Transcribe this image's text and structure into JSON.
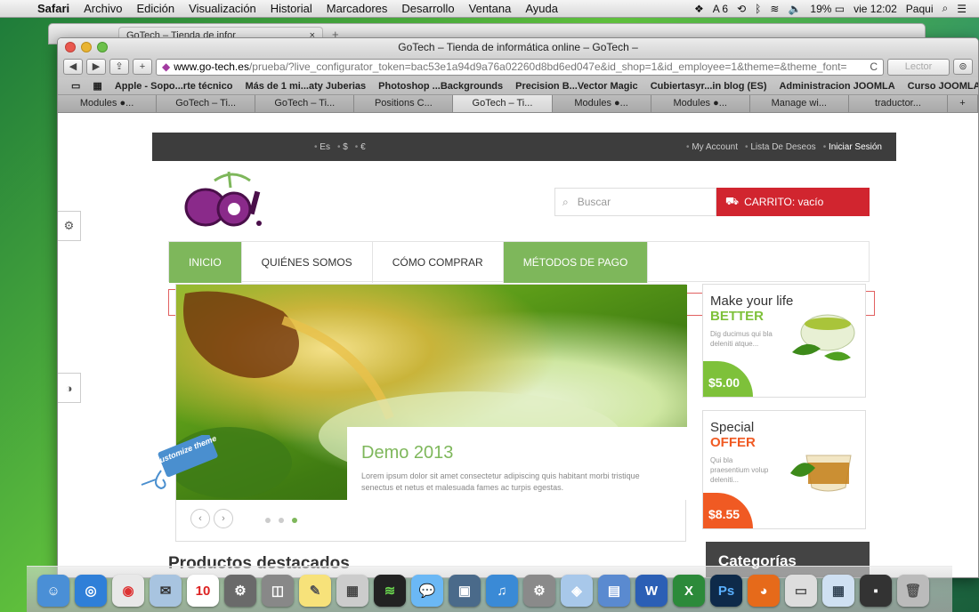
{
  "menubar": {
    "items": [
      "Safari",
      "Archivo",
      "Edición",
      "Visualización",
      "Historial",
      "Marcadores",
      "Desarrollo",
      "Ventana",
      "Ayuda"
    ],
    "status": {
      "adobe": "6",
      "battery": "19%",
      "clock": "vie 12:02",
      "user": "Paqui"
    }
  },
  "bg_window": {
    "tab_title": "GoTech – Tienda de infor",
    "tab_close": "×",
    "new_tab": "+"
  },
  "window": {
    "title": "GoTech – Tienda de informática online – GoTech –"
  },
  "toolbar": {
    "back": "◀",
    "forward": "▶",
    "share": "⇪",
    "add": "+",
    "url_domain": "www.go-tech.es",
    "url_path": "/prueba/?live_configurator_token=bac53e1a94d9a76a02260d8bd6ed047e&id_shop=1&id_employee=1&theme=&theme_font=",
    "reload": "C",
    "reader": "Lector"
  },
  "bookmarks": [
    "Apple - Sopo...rte técnico",
    "Más de 1 mi...aty Juberias",
    "Photoshop ...Backgrounds",
    "Precision B...Vector Magic",
    "Cubiertasyr...in blog (ES)",
    "Administracion JOOMLA",
    "Curso JOOMLA"
  ],
  "tabs": [
    "Modules ●...",
    "GoTech – Ti...",
    "GoTech – Ti...",
    "Positions C...",
    "GoTech – Ti...",
    "Modules ●...",
    "Modules ●...",
    "Manage wi...",
    "traductor..."
  ],
  "active_tab": 4,
  "site": {
    "topstrip": {
      "langs": [
        "Es",
        "$",
        "€"
      ],
      "account": [
        "My Account",
        "Lista De Deseos",
        "Iniciar Sesión"
      ]
    },
    "search_placeholder": "Buscar",
    "cart_label": "CARRITO: vacío",
    "nav": [
      "INICIO",
      "QUIÉNES SOMOS",
      "CÓMO COMPRAR",
      "MÉTODOS DE PAGO"
    ],
    "slide": {
      "title": "Demo 2013",
      "text": "Lorem ipsum dolor sit amet consectetur adipiscing quis habitant morbi tristique senectus et netus et malesuada fames ac turpis egestas."
    },
    "promo1": {
      "line1": "Make your life",
      "line2": "BETTER",
      "desc": "Dig ducimus qui bla deleniti atque...",
      "price": "$5.00",
      "color": "#7ec13a"
    },
    "promo2": {
      "line1": "Special",
      "line2": "OFFER",
      "desc": "Qui bla praesentium volup deleniti...",
      "price": "$8.55",
      "color": "#f05a23"
    },
    "featured": "Productos destacados",
    "categories": "Categorías",
    "customize_badge": "customize theme",
    "accent": "#7eb75b",
    "cart_color": "#d1252f"
  }
}
